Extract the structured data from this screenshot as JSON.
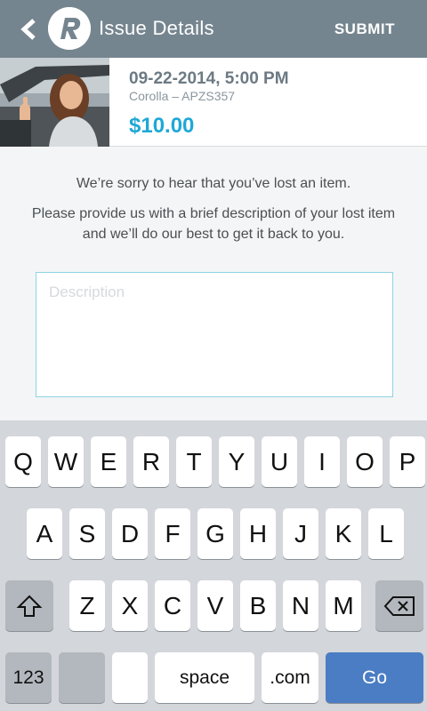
{
  "header": {
    "title": "Issue Details",
    "submit_label": "SUBMIT",
    "back_icon": "chevron-left-icon",
    "logo_icon": "app-logo-icon"
  },
  "ride": {
    "date_time": "09-22-2014, 5:00 PM",
    "car": "Corolla – APZS357",
    "price": "$10.00"
  },
  "message": {
    "line1": "We’re sorry to hear that you’ve lost an item.",
    "line2": "Please provide us with a brief description of your lost item and we’ll do our best to get it back to you."
  },
  "description": {
    "placeholder": "Description",
    "value": ""
  },
  "keyboard": {
    "row1": [
      "Q",
      "W",
      "E",
      "R",
      "T",
      "Y",
      "U",
      "I",
      "O",
      "P"
    ],
    "row2": [
      "A",
      "S",
      "D",
      "F",
      "G",
      "H",
      "J",
      "K",
      "L"
    ],
    "row3": [
      "Z",
      "X",
      "C",
      "V",
      "B",
      "N",
      "M"
    ],
    "shift_icon": "shift-icon",
    "backspace_icon": "backspace-icon",
    "numbers_label": "123",
    "space_label": "space",
    "com_label": ".com",
    "go_label": "Go"
  },
  "colors": {
    "header_bg": "#75858f",
    "price": "#1fa8d6",
    "go_key": "#4a7dc4",
    "input_border": "#8fd3e6"
  }
}
